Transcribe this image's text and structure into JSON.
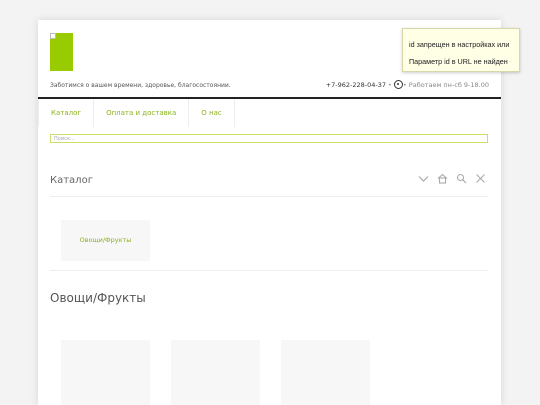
{
  "header": {
    "logo_name": "logo-image",
    "tagline": "Заботимся о вашем времени, здоровье, благосостоянии.",
    "phone": "+7-962-228-04-37",
    "separator": "•",
    "whatsapp_icon": "whatsapp-icon",
    "hours": "• Работаем пн-сб 9-18.00"
  },
  "nav": {
    "items": [
      {
        "label": "Каталог"
      },
      {
        "label": "Оплата и доставка"
      },
      {
        "label": "О нас"
      }
    ]
  },
  "search": {
    "placeholder": "Поиск..."
  },
  "catalog": {
    "title": "Каталог",
    "icons": [
      "chevron-down-icon",
      "home-icon",
      "search-icon",
      "close-icon"
    ],
    "categories": [
      {
        "label": "Овощи/Фрукты"
      }
    ]
  },
  "section": {
    "title": "Овощи/Фрукты"
  },
  "tooltip": {
    "line1": "id запрещен в настройках или",
    "line2": "Параметр id в URL не найден"
  },
  "colors": {
    "accent": "#8bb31f",
    "logo": "#99cc00"
  }
}
